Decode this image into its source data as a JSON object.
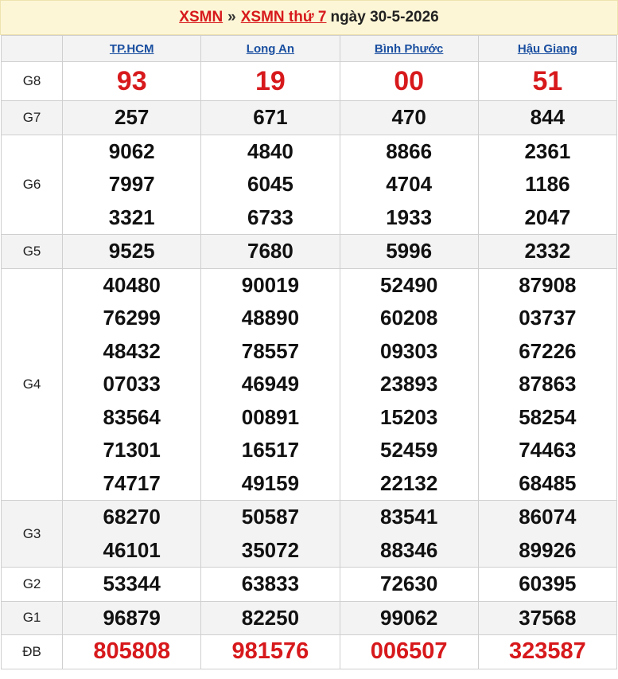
{
  "header": {
    "link1": "XSMN",
    "sep": "»",
    "link2": "XSMN thứ 7",
    "date": "ngày 30-5-2026"
  },
  "provinces": [
    "TP.HCM",
    "Long An",
    "Bình Phước",
    "Hậu Giang"
  ],
  "prizes": [
    {
      "label": "G8",
      "results": [
        [
          "93"
        ],
        [
          "19"
        ],
        [
          "00"
        ],
        [
          "51"
        ]
      ]
    },
    {
      "label": "G7",
      "results": [
        [
          "257"
        ],
        [
          "671"
        ],
        [
          "470"
        ],
        [
          "844"
        ]
      ]
    },
    {
      "label": "G6",
      "results": [
        [
          "9062",
          "7997",
          "3321"
        ],
        [
          "4840",
          "6045",
          "6733"
        ],
        [
          "8866",
          "4704",
          "1933"
        ],
        [
          "2361",
          "1186",
          "2047"
        ]
      ]
    },
    {
      "label": "G5",
      "results": [
        [
          "9525"
        ],
        [
          "7680"
        ],
        [
          "5996"
        ],
        [
          "2332"
        ]
      ]
    },
    {
      "label": "G4",
      "results": [
        [
          "40480",
          "76299",
          "48432",
          "07033",
          "83564",
          "71301",
          "74717"
        ],
        [
          "90019",
          "48890",
          "78557",
          "46949",
          "00891",
          "16517",
          "49159"
        ],
        [
          "52490",
          "60208",
          "09303",
          "23893",
          "15203",
          "52459",
          "22132"
        ],
        [
          "87908",
          "03737",
          "67226",
          "87863",
          "58254",
          "74463",
          "68485"
        ]
      ]
    },
    {
      "label": "G3",
      "results": [
        [
          "68270",
          "46101"
        ],
        [
          "50587",
          "35072"
        ],
        [
          "83541",
          "88346"
        ],
        [
          "86074",
          "89926"
        ]
      ]
    },
    {
      "label": "G2",
      "results": [
        [
          "53344"
        ],
        [
          "63833"
        ],
        [
          "72630"
        ],
        [
          "60395"
        ]
      ]
    },
    {
      "label": "G1",
      "results": [
        [
          "96879"
        ],
        [
          "82250"
        ],
        [
          "99062"
        ],
        [
          "37568"
        ]
      ]
    },
    {
      "label": "ĐB",
      "results": [
        [
          "805808"
        ],
        [
          "981576"
        ],
        [
          "006507"
        ],
        [
          "323587"
        ]
      ]
    }
  ],
  "colors": {
    "accent": "#d7191c",
    "link": "#1a4fa0",
    "header_bg": "#fdf6d6",
    "alt_row_bg": "#f3f3f3"
  }
}
